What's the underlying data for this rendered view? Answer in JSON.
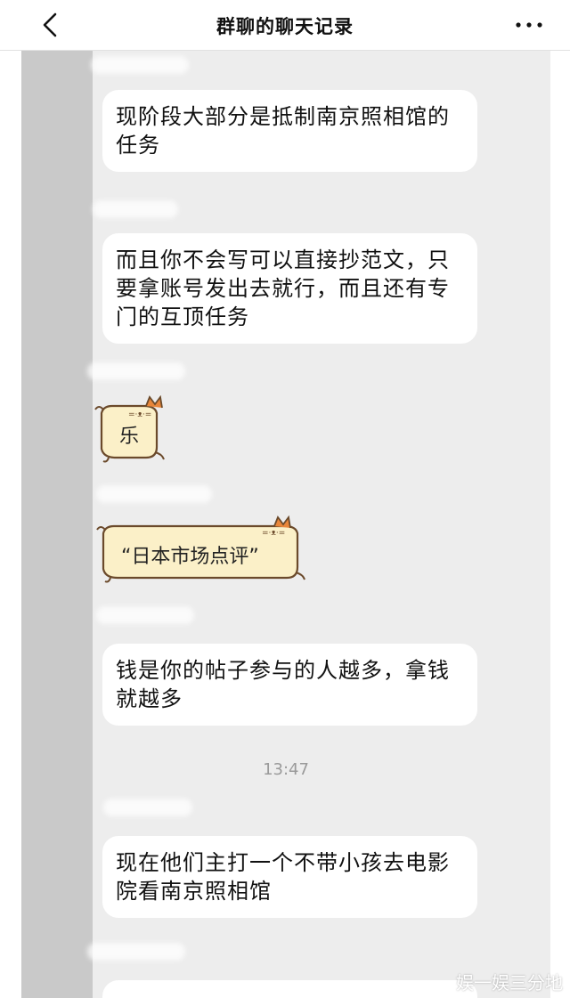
{
  "header": {
    "title": "群聊的聊天记录",
    "back_icon": "chevron-left-icon",
    "more_icon": "more-dots-icon"
  },
  "messages": [
    {
      "text": "现阶段大部分是抵制南京照相馆的\n任务"
    },
    {
      "text": "而且你不会写可以直接抄范文，只\n要拿账号发出去就行，而且还有专\n门的互顶任务"
    },
    {
      "text": "钱是你的帖子参与的人越多，拿钱\n就越多"
    },
    {
      "text": "现在他们主打一个不带小孩去电影\n院看南京照相馆"
    }
  ],
  "stickers": [
    {
      "text": "乐"
    },
    {
      "text": "“日本市场点评”"
    }
  ],
  "timestamp": "13:47",
  "watermark": "娱一娱三分地",
  "colors": {
    "chat_bg": "#ededed",
    "bubble_bg": "#ffffff",
    "sticker_bg": "#fbf0c8",
    "sticker_outline": "#6b4a2b",
    "cat_orange": "#e8863a"
  }
}
